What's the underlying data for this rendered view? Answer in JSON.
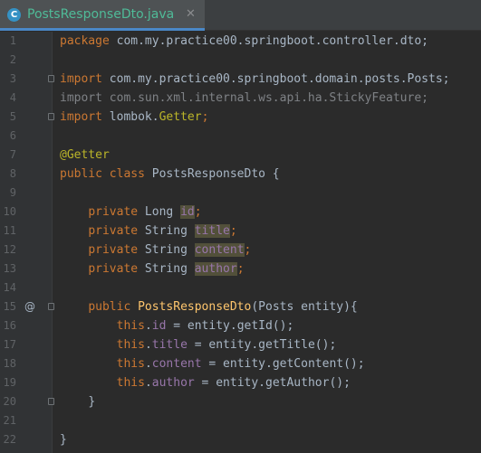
{
  "tab": {
    "icon_letter": "C",
    "filename": "PostsResponseDto.java",
    "close_glyph": "✕"
  },
  "gutter": {
    "override_marker": "@"
  },
  "lines": [
    {
      "n": "1"
    },
    {
      "n": "2"
    },
    {
      "n": "3"
    },
    {
      "n": "4"
    },
    {
      "n": "5"
    },
    {
      "n": "6"
    },
    {
      "n": "7"
    },
    {
      "n": "8"
    },
    {
      "n": "9"
    },
    {
      "n": "10"
    },
    {
      "n": "11"
    },
    {
      "n": "12"
    },
    {
      "n": "13"
    },
    {
      "n": "14"
    },
    {
      "n": "15"
    },
    {
      "n": "16"
    },
    {
      "n": "17"
    },
    {
      "n": "18"
    },
    {
      "n": "19"
    },
    {
      "n": "20"
    },
    {
      "n": "21"
    },
    {
      "n": "22"
    }
  ],
  "tokens": {
    "package_kw": "package",
    "package_name": " com.my.practice00.springboot.controller.dto;",
    "import_kw": "import",
    "import1_name": " com.my.practice00.springboot.domain.posts.Posts;",
    "import2_full": "import com.sun.xml.internal.ws.api.ha.StickyFeature;",
    "import3_pkg": " lombok.",
    "import3_cls": "Getter",
    "semicolon": ";",
    "annotation": "@Getter",
    "class_mods": "public class",
    "class_name": " PostsResponseDto {",
    "private_kw": "private",
    "type_long": " Long ",
    "type_string": " String ",
    "field_id": "id",
    "field_title": "title",
    "field_content": "content",
    "field_author": "author",
    "public_kw": "public",
    "ctor_name": "PostsResponseDto",
    "ctor_params": "(Posts entity){",
    "this_kw": "this",
    "dot": ".",
    "assign_id": " = entity.getId();",
    "assign_title": " = entity.getTitle();",
    "assign_content": " = entity.getContent();",
    "assign_author": " = entity.getAuthor();",
    "close_brace": "}",
    "colors": {
      "keyword": "#cc7832",
      "annotation": "#bbb529",
      "field": "#9876aa",
      "method": "#ffc66d",
      "default": "#a9b7c6",
      "unused_import": "#7f8286",
      "tab_text": "#4fbb98"
    }
  }
}
